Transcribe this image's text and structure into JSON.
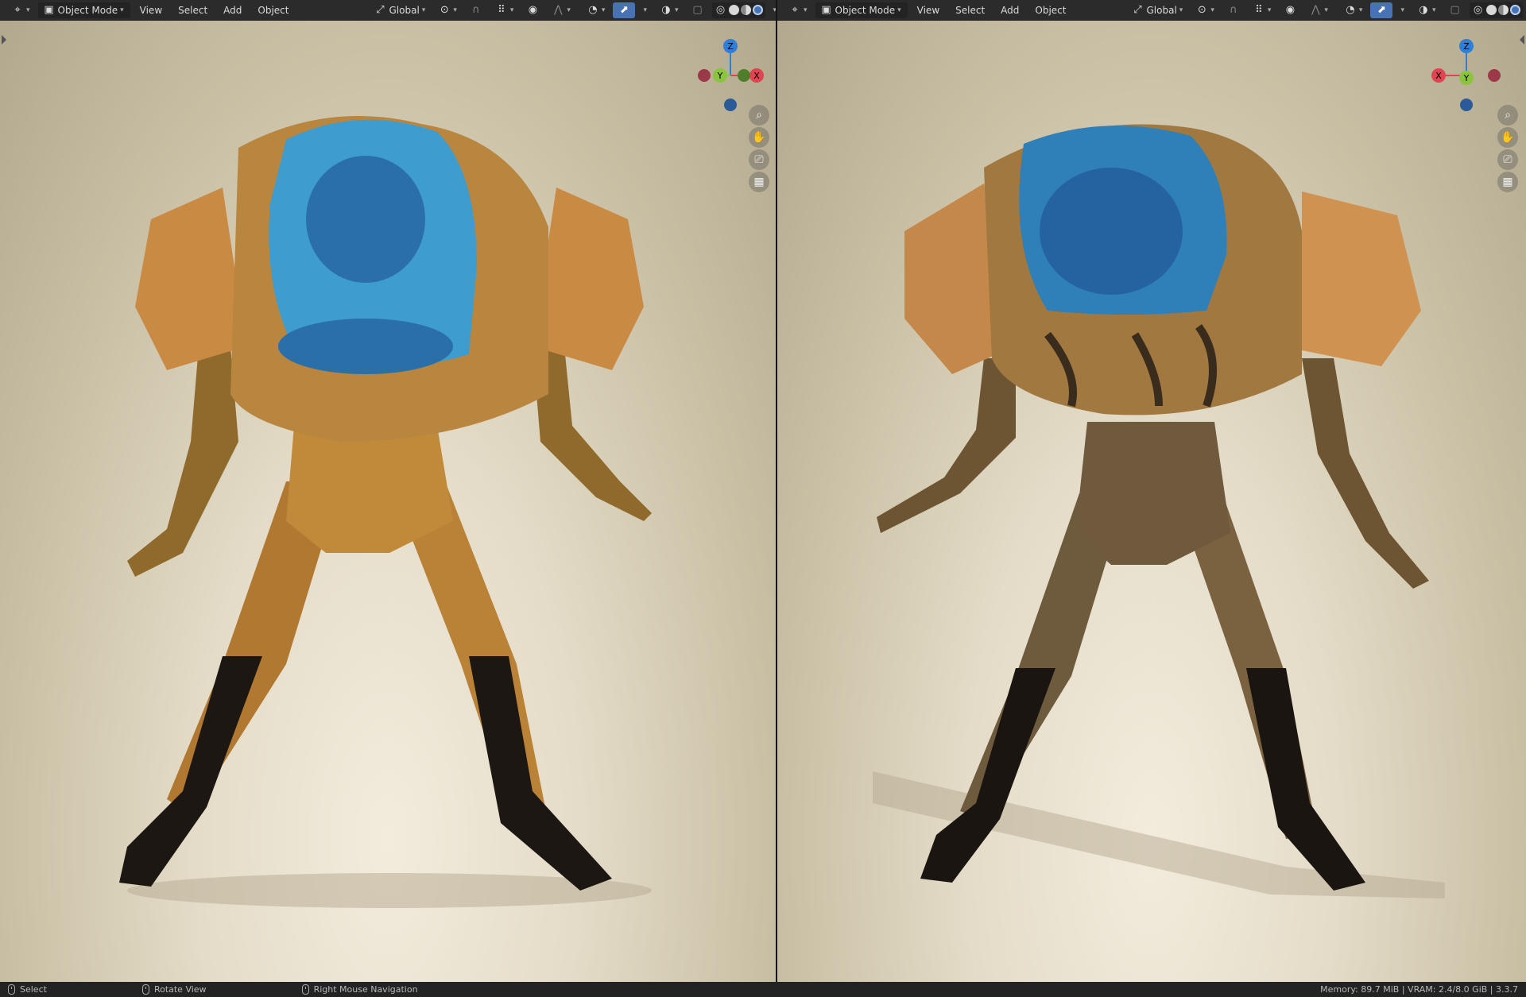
{
  "viewports": [
    {
      "id": "left",
      "mode_label": "Object Mode",
      "menus": [
        "View",
        "Select",
        "Add",
        "Object"
      ],
      "transform_orientation": "Global",
      "gizmo": {
        "z": "Z",
        "y": "Y",
        "x": "X"
      }
    },
    {
      "id": "right",
      "mode_label": "Object Mode",
      "menus": [
        "View",
        "Select",
        "Add",
        "Object"
      ],
      "transform_orientation": "Global",
      "gizmo": {
        "z": "Z",
        "y": "Y",
        "x": "X"
      }
    }
  ],
  "icons": {
    "editor_type": "editor-type-icon",
    "object_mode": "object-mode-icon",
    "orientation": "transform-orientation-icon",
    "pivot": "pivot-point-icon",
    "snap": "snap-icon",
    "snap_increment": "snap-increment-icon",
    "proportional": "proportional-editing-icon",
    "falloff": "falloff-icon",
    "visibility": "visibility-icon",
    "gizmo_toggle": "gizmo-toggle-icon",
    "overlays": "overlays-icon",
    "xray": "xray-icon",
    "shading": [
      "wireframe-shading-icon",
      "solid-shading-icon",
      "material-shading-icon",
      "rendered-shading-icon"
    ],
    "nav": [
      "zoom-icon",
      "pan-hand-icon",
      "camera-icon",
      "ortho-grid-icon"
    ]
  },
  "colors": {
    "header_bg": "#2b2b2b",
    "accent": "#4772b3",
    "axis_x": "#e04451",
    "axis_y": "#8bc53f",
    "axis_z": "#2f7fd8",
    "status_bg": "#232323"
  },
  "statusbar": {
    "select": "Select",
    "rotate_view": "Rotate View",
    "right_mouse_nav": "Right Mouse Navigation",
    "stats": "Memory: 89.7 MiB | VRAM: 2.4/8.0 GiB | 3.3.7"
  }
}
